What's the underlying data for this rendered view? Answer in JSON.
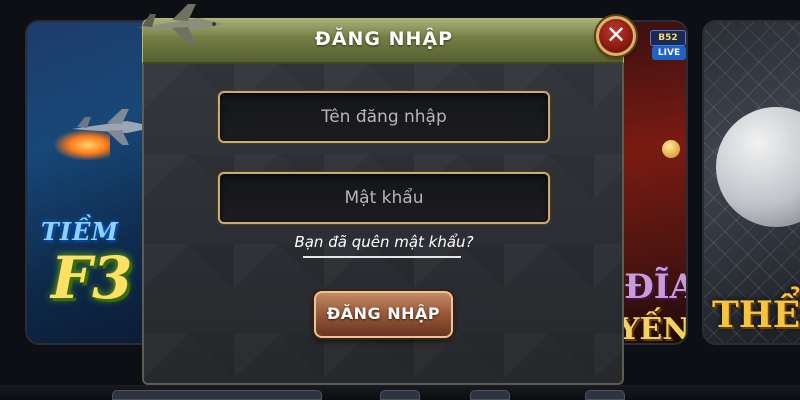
{
  "background": {
    "left_tile": {
      "logo_small": "TIỀM",
      "logo_big": "F3"
    },
    "mid_tile": {
      "badge": "B52",
      "live_badge": "LIVE",
      "word_top": "ĐĨA",
      "word_bottom": "YẾN"
    },
    "right_tile": {
      "word": "THỂ"
    }
  },
  "modal": {
    "title": "ĐĂNG NHẬP",
    "close_symbol": "✕",
    "username_placeholder": "Tên đăng nhập",
    "password_placeholder": "Mật khẩu",
    "forgot_password_link": "Bạn đã quên mật khẩu?",
    "submit_label": "ĐĂNG NHẬP"
  },
  "colors": {
    "header_green": "#6e7840",
    "field_border_gold": "#c9ac72",
    "button_brown": "#9b5b3b",
    "close_red": "#8a1b12"
  },
  "icons": {
    "close": "close-icon",
    "plane": "airplane-icon"
  }
}
